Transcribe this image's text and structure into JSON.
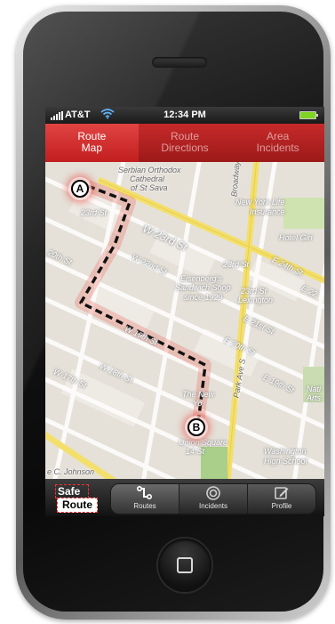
{
  "status_bar": {
    "carrier": "AT&T",
    "time": "12:34 PM",
    "battery_color": "#7fd321"
  },
  "top_tabs": [
    {
      "line1": "Route",
      "line2": "Map",
      "active": true
    },
    {
      "line1": "Route",
      "line2": "Directions",
      "active": false
    },
    {
      "line1": "Area",
      "line2": "Incidents",
      "active": false
    }
  ],
  "map": {
    "labels": {
      "church1": "Serbian Orthodox",
      "church2": "Cathedral",
      "church3": "of St Sava",
      "w23_small": "23rd St",
      "w23": "W 23rd St",
      "nylife1": "New York Life",
      "nylife2": "Insurance",
      "hotel": "Hotel Giri",
      "w22": "W 22nd St",
      "w20th": "20th St",
      "station": "23rd St",
      "e24": "E 24th St",
      "eisenberg1": "Eisenberg's",
      "eisenberg2": "Sandwich Shop",
      "eisenberg3": "since 1929",
      "lexington1": "23rd St",
      "lexington2": "Lexington",
      "e22": "E 22",
      "e21": "E 21st St",
      "e20": "E 20th St",
      "w19": "W 19th St",
      "w18": "W 18th St",
      "w17": "W 17th St",
      "thenew1": "The New",
      "thenew2": "Yo",
      "e19": "E 19th St",
      "nat1": "Nati",
      "nat2": "Arts",
      "union1": "Union Square",
      "union2": "14 St",
      "washington1": "Washington",
      "washington2": "High School",
      "johnson": "e C. Johnson",
      "broadway": "Broadway",
      "parkave": "Park Ave S"
    },
    "marker_a": "A",
    "marker_b": "B",
    "route_color": "#111111",
    "road_color": "#f3df6c"
  },
  "tab_bar": {
    "brand_top": "Safe",
    "brand_bottom": "Route",
    "items": [
      {
        "label": "Routes",
        "icon": "route-icon",
        "active": true
      },
      {
        "label": "Incidents",
        "icon": "target-icon",
        "active": false
      },
      {
        "label": "Profile",
        "icon": "edit-profile-icon",
        "active": false
      }
    ]
  },
  "colors": {
    "header_red": "#c62a2a",
    "header_active_red": "#e14343"
  }
}
